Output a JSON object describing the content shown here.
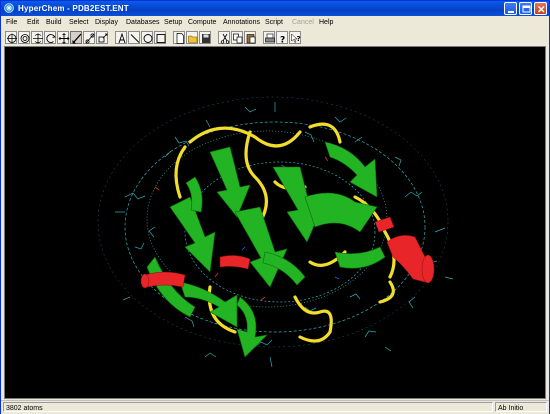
{
  "window": {
    "title": "HyperChem - PDB2EST.ENT"
  },
  "menu": [
    {
      "label": "File",
      "enabled": true
    },
    {
      "label": "Edit",
      "enabled": true
    },
    {
      "label": "Build",
      "enabled": true
    },
    {
      "label": "Select",
      "enabled": true
    },
    {
      "label": "Display",
      "enabled": true
    },
    {
      "label": "Databases",
      "enabled": true
    },
    {
      "label": "Setup",
      "enabled": true
    },
    {
      "label": "Compute",
      "enabled": true
    },
    {
      "label": "Annotations",
      "enabled": true
    },
    {
      "label": "Script",
      "enabled": true
    },
    {
      "label": "Cancel",
      "enabled": false
    },
    {
      "label": "Help",
      "enabled": true
    }
  ],
  "toolbar": {
    "tools": [
      "draw-tool-icon",
      "select-tool-icon",
      "rotate-xy-icon",
      "rotate-z-icon",
      "translate-xy-icon",
      "translate-z-icon",
      "zoom-icon",
      "clip-icon"
    ],
    "annotation_tools": [
      "text-tool-icon",
      "line-tool-icon",
      "ellipse-tool-icon",
      "rectangle-tool-icon"
    ],
    "file_tools": [
      "new-file-icon",
      "open-file-icon",
      "save-file-icon"
    ],
    "edit_tools": [
      "cut-icon",
      "copy-icon",
      "paste-icon"
    ],
    "misc_tools": [
      "print-icon",
      "help-icon",
      "context-help-icon"
    ]
  },
  "status": {
    "atoms": "3802 atoms",
    "method": "Ab Initio"
  },
  "colors": {
    "title_bar": "#0a4fd6",
    "viewport_bg": "#000000",
    "helix": "#e8262a",
    "sheet": "#22b422",
    "coil": "#f3dc2a",
    "atoms": "#3cc9d4"
  }
}
